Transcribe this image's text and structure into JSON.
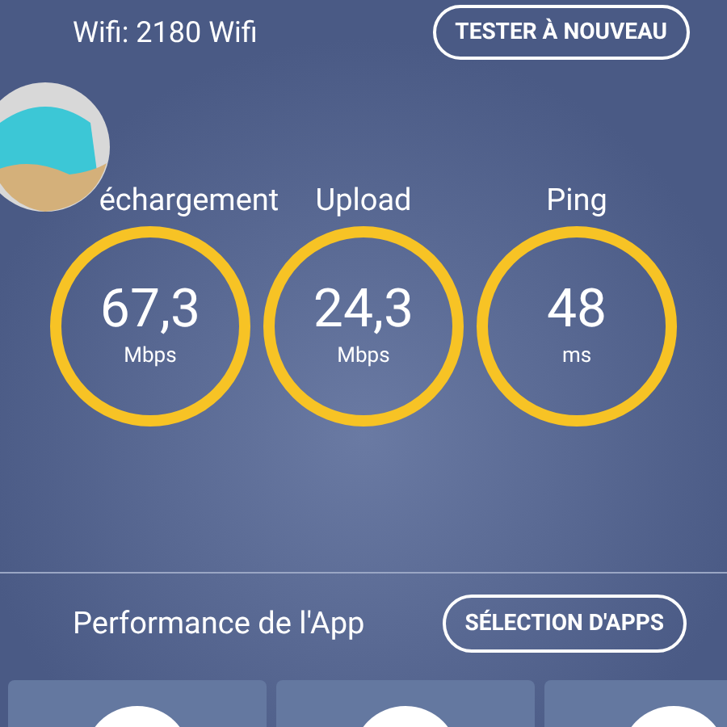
{
  "network": {
    "label": "Wifi: 2180 Wifi",
    "retest_button": "TESTER À NOUVEAU"
  },
  "metrics": [
    {
      "label": "échargement",
      "value": "67,3",
      "unit": "Mbps"
    },
    {
      "label": "Upload",
      "value": "24,3",
      "unit": "Mbps"
    },
    {
      "label": "Ping",
      "value": "48",
      "unit": "ms"
    }
  ],
  "app_performance": {
    "title": "Performance de l'App",
    "select_button": "SÉLECTION D'APPS",
    "cards": [
      {
        "kind": "app"
      },
      {
        "kind": "app"
      },
      {
        "kind": "app"
      }
    ]
  }
}
